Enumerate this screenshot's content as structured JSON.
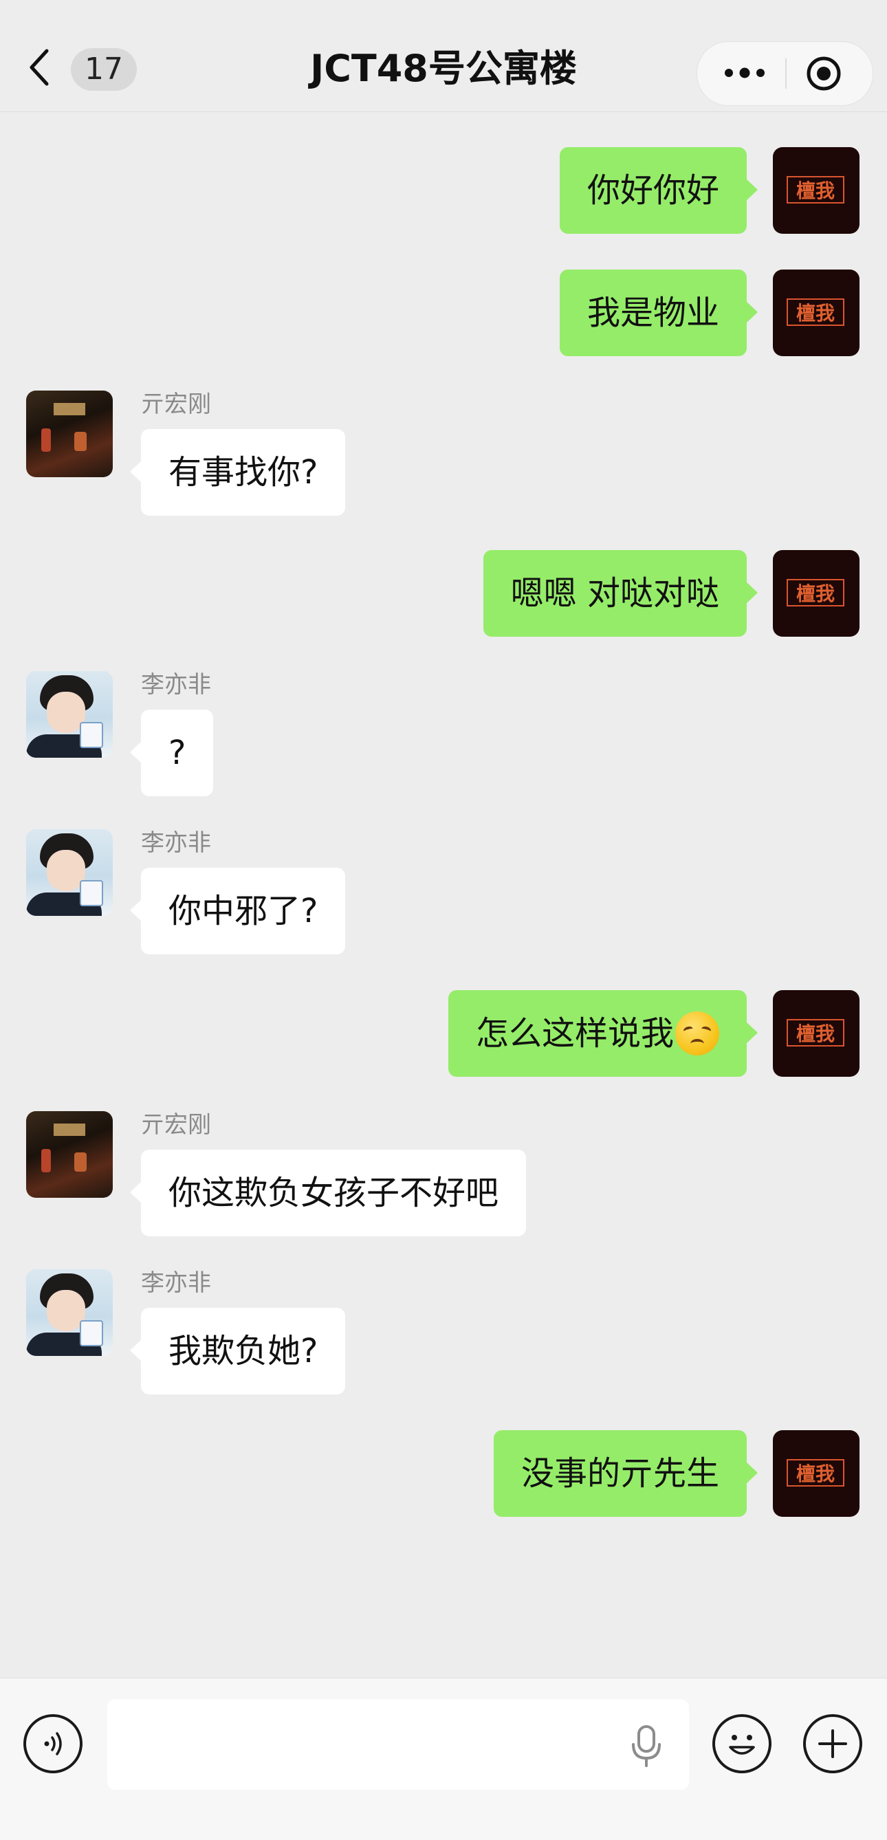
{
  "header": {
    "unread_count": "17",
    "title": "JCT48号公寓楼"
  },
  "self_avatar_text": "檀我",
  "messages": [
    {
      "side": "self",
      "text": "你好你好"
    },
    {
      "side": "self",
      "text": "我是物业"
    },
    {
      "side": "other",
      "sender": "亓宏刚",
      "avatar": "yhg",
      "text": "有事找你?"
    },
    {
      "side": "self",
      "text": "嗯嗯 对哒对哒"
    },
    {
      "side": "other",
      "sender": "李亦非",
      "avatar": "lyf",
      "text": "?"
    },
    {
      "side": "other",
      "sender": "李亦非",
      "avatar": "lyf",
      "text": "你中邪了?"
    },
    {
      "side": "self",
      "text": "怎么这样说我",
      "emoji": "disappointed-face"
    },
    {
      "side": "other",
      "sender": "亓宏刚",
      "avatar": "yhg",
      "text": "你这欺负女孩子不好吧"
    },
    {
      "side": "other",
      "sender": "李亦非",
      "avatar": "lyf",
      "text": "我欺负她?"
    },
    {
      "side": "self",
      "text": "没事的亓先生"
    }
  ],
  "input": {
    "value": "",
    "icons": [
      "voice-icon",
      "microphone-icon",
      "emoji-icon",
      "plus-icon"
    ]
  },
  "colors": {
    "self_bubble": "#95ec69",
    "other_bubble": "#ffffff",
    "background": "#ededed"
  }
}
